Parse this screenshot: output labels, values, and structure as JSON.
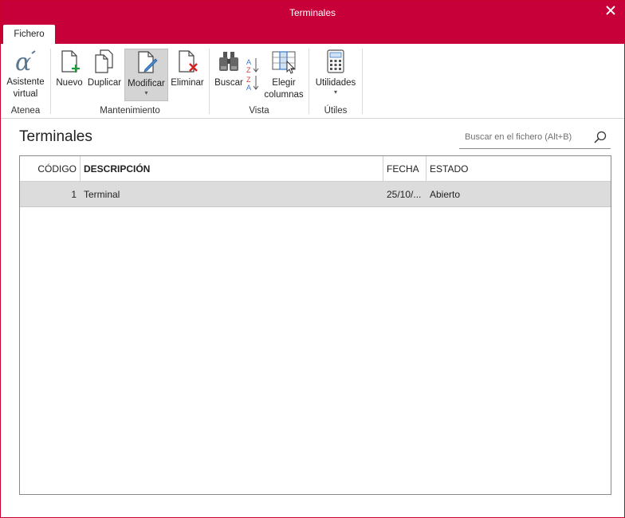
{
  "window": {
    "title": "Terminales"
  },
  "tabs": {
    "active_label": "Fichero"
  },
  "ribbon": {
    "groups": [
      {
        "label": "Atenea",
        "buttons": [
          {
            "label1": "Asistente",
            "label2": "virtual",
            "icon": "alpha-icon"
          }
        ]
      },
      {
        "label": "Mantenimiento",
        "buttons": [
          {
            "label": "Nuevo",
            "icon": "new-document-icon"
          },
          {
            "label": "Duplicar",
            "icon": "duplicate-icon"
          },
          {
            "label": "Modificar",
            "icon": "edit-document-icon"
          },
          {
            "label": "Eliminar",
            "icon": "delete-document-icon"
          }
        ]
      },
      {
        "label": "Vista",
        "buttons": [
          {
            "label": "Buscar",
            "icon": "binoculars-icon"
          },
          {
            "label": "",
            "icon": "sort-icon"
          },
          {
            "label1": "Elegir",
            "label2": "columnas",
            "icon": "choose-columns-icon"
          }
        ]
      },
      {
        "label": "Útiles",
        "buttons": [
          {
            "label": "Utilidades",
            "icon": "calculator-icon"
          }
        ]
      }
    ]
  },
  "main": {
    "title": "Terminales",
    "search": {
      "placeholder": "Buscar en el fichero (Alt+B)"
    }
  },
  "table": {
    "columns": [
      "CÓDIGO",
      "DESCRIPCIÓN",
      "FECHA",
      "ESTADO"
    ],
    "rows": [
      {
        "codigo": "1",
        "descripcion": "Terminal",
        "fecha": "25/10/...",
        "estado": "Abierto"
      }
    ]
  },
  "colors": {
    "accent": "#c8003a",
    "selected_row": "#dcdcdc"
  }
}
